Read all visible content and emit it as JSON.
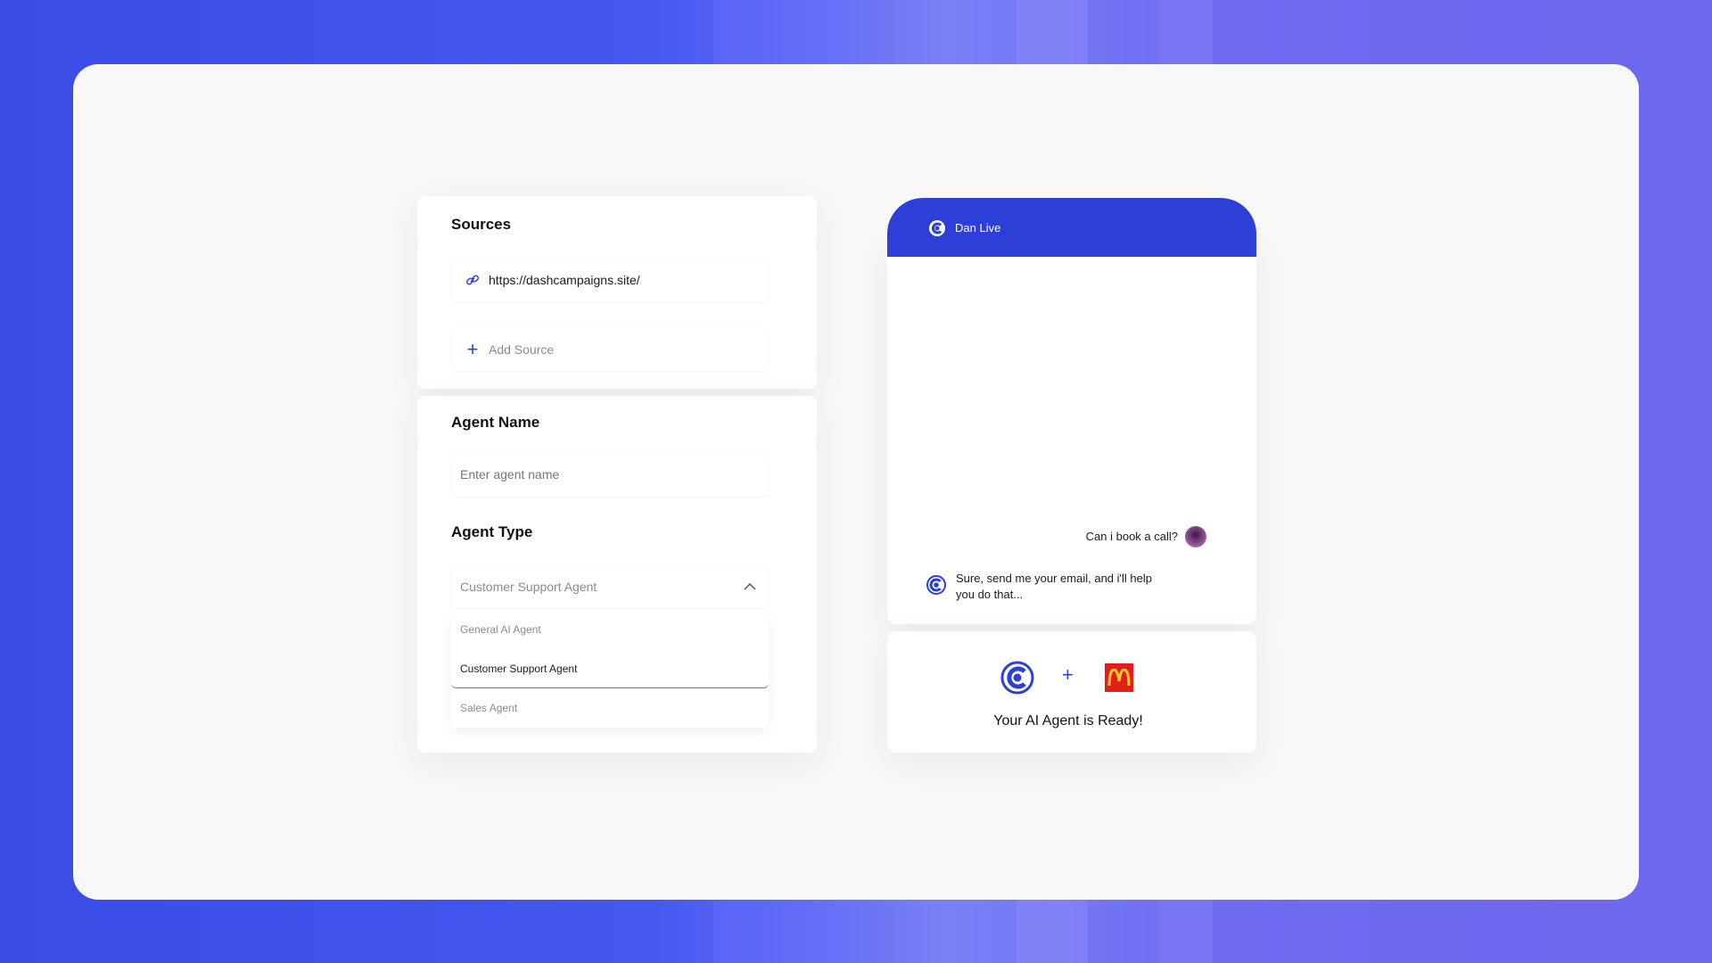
{
  "sources": {
    "title": "Sources",
    "url": "https://dashcampaigns.site/",
    "add_label": "Add Source"
  },
  "agent": {
    "name_title": "Agent Name",
    "name_placeholder": "Enter agent name",
    "type_title": "Agent Type",
    "type_selected": "Customer Support Agent",
    "type_options": [
      "General AI Agent",
      "Customer Support Agent",
      "Sales Agent"
    ]
  },
  "chat": {
    "header_title": "Dan Live",
    "user_message": "Can i book a call?",
    "bot_reply_line1": "Sure, send me your email, and i'll help",
    "bot_reply_line2": "you do that..."
  },
  "ready": {
    "plus": "+",
    "title": "Your AI Agent is Ready!"
  },
  "colors": {
    "brand_blue": "#2d3fd6",
    "mcd_red": "#e31d1a",
    "mcd_yellow": "#ffc72c"
  },
  "icons": {
    "link": "link-icon",
    "plus": "plus-icon",
    "chevron": "chevron-up-icon",
    "brand": "brand-logo-icon",
    "avatar": "user-avatar",
    "mcdonalds": "mcdonalds-logo"
  }
}
